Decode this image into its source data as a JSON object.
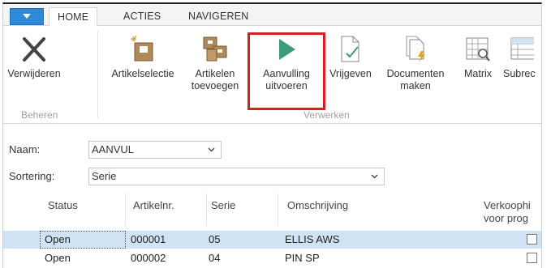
{
  "tabs": {
    "home": "HOME",
    "acties": "ACTIES",
    "navigeren": "NAVIGEREN"
  },
  "ribbon": {
    "verwijderen": "Verwijderen",
    "artikelselectie": "Artikelselectie",
    "artikelen_line1": "Artikelen",
    "artikelen_line2": "toevoegen",
    "aanvulling_line1": "Aanvulling",
    "aanvulling_line2": "uitvoeren",
    "vrijgeven": "Vrijgeven",
    "documenten_line1": "Documenten",
    "documenten_line2": "maken",
    "matrix": "Matrix",
    "subrec": "Subrec",
    "group_beheren": "Beheren",
    "group_verwerken": "Verwerken"
  },
  "filters": {
    "naam_label": "Naam:",
    "naam_value": "AANVUL",
    "sortering_label": "Sortering:",
    "sortering_value": "Serie"
  },
  "grid": {
    "columns": {
      "status": "Status",
      "artikelnr": "Artikelnr.",
      "serie": "Serie",
      "omschrijving": "Omschrijving",
      "verkoop_line1": "Verkoophi",
      "verkoop_line2": "voor prog"
    },
    "rows": [
      {
        "status": "Open",
        "artikelnr": "000001",
        "serie": "05",
        "omschrijving": "ELLIS AWS",
        "checked": false
      },
      {
        "status": "Open",
        "artikelnr": "000002",
        "serie": "04",
        "omschrijving": "PIN SP",
        "checked": false
      }
    ]
  },
  "colors": {
    "app_button": "#2e8ad8",
    "highlight": "#d62020",
    "selected_row": "#cfe3f5",
    "play_icon": "#3d9a7a",
    "folder_icon": "#b0895a"
  }
}
